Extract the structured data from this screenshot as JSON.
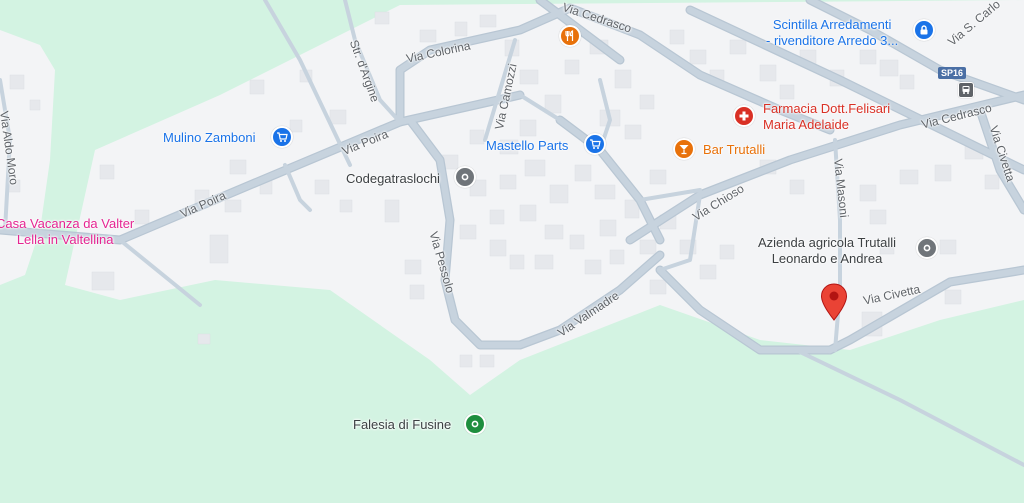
{
  "colors": {
    "land": "#f3f4f6",
    "park": "#d3f3e2",
    "road": "#c5d2dd",
    "road_outline": "#b3c3d1",
    "building": "#e8eaed",
    "road_text": "#5f6368",
    "shopping": "#1a73e8",
    "food": "#e8710a",
    "health": "#d93025",
    "lodging": "#e52592",
    "generic": "#70757a",
    "nature": "#1e8e3e",
    "marker": "#ea4335"
  },
  "roads": {
    "via_cedrasco_top": "Via Cedrasco",
    "via_s_carlo": "Via S. Carlo",
    "via_colorina": "Via Colorina",
    "str_d_argine": "Str. d'Argine",
    "via_camozzi": "Via Camozzi",
    "via_poira_1": "Via Poira",
    "via_poira_2": "Via Poira",
    "via_aldo_moro": "Via Aldo Moro",
    "via_pessolo": "Via Pessolo",
    "via_valmadre": "Via Valmadre",
    "via_chioso": "Via Chioso",
    "via_masoni": "Via Masoni",
    "via_civetta_1": "Via Civetta",
    "via_civetta_2": "Via Civetta",
    "via_cedrasco_right": "Via Cedrasco",
    "sp16": "SP16"
  },
  "places": {
    "scintilla_line1": "Scintilla Arredamenti",
    "scintilla_line2": "- rivenditore Arredo 3...",
    "farmacia_line1": "Farmacia Dott.Felisari",
    "farmacia_line2": "Maria Adelaide",
    "bar_trutalli": "Bar Trutalli",
    "mastello_parts": "Mastello Parts",
    "mulino_zamboni": "Mulino Zamboni",
    "codegatraslochi": "Codegatraslochi",
    "casa_vacanza_line1": "Casa Vacanza da Valter",
    "casa_vacanza_line2": "Lella in Valtellina",
    "azienda_line1": "Azienda agricola Trutalli",
    "azienda_line2": "Leonardo e Andrea",
    "falesia": "Falesia di Fusine"
  },
  "icons": {
    "shopping": "shopping-cart-icon",
    "restaurant": "restaurant-icon",
    "bar": "cocktail-bar-icon",
    "pharmacy": "pharmacy-icon",
    "generic": "place-icon",
    "nature": "park-icon",
    "lodging": "lock-icon",
    "transit": "bus-stop-icon",
    "marker": "location-marker-icon"
  }
}
